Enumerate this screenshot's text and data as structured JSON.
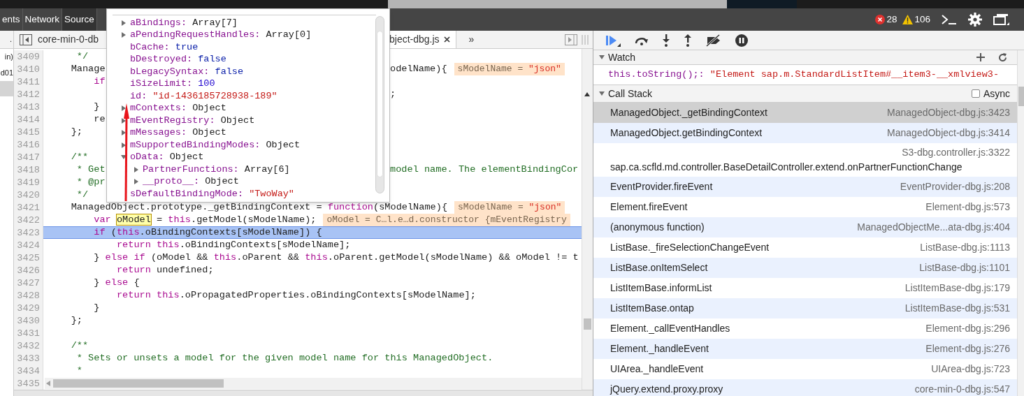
{
  "main_toolbar": {
    "tabs": [
      {
        "label": "ents",
        "selected": false
      },
      {
        "label": "Network",
        "selected": false
      },
      {
        "label": "Source",
        "selected": true
      }
    ],
    "errors": "28",
    "warnings": "106"
  },
  "navigator": {
    "header": ".",
    "items": [
      {
        "label": "in)",
        "selected": false
      },
      {
        "label": "d01",
        "selected": false
      }
    ]
  },
  "editor_tabs": [
    {
      "label": "core-min-0-db",
      "selected": false
    },
    {
      "label": "bject-dbg.js",
      "selected": true
    }
  ],
  "more_tabs": "»",
  "code": {
    "lines": [
      {
        "number": "3409",
        "kind": "comment",
        "text": "     */",
        "current": false
      },
      {
        "number": "3410",
        "kind": "code",
        "text": "    Manage",
        "right": "odelName){",
        "inline": {
          "name": "sModelName =",
          "value": "\"json\""
        },
        "current": false
      },
      {
        "number": "3411",
        "kind": "code",
        "text": "        if",
        "current": false
      },
      {
        "number": "3412",
        "kind": "code",
        "right": ";",
        "current": false
      },
      {
        "number": "3413",
        "kind": "code",
        "text": "        }",
        "current": false
      },
      {
        "number": "3414",
        "kind": "code",
        "text": "        re",
        "current": false
      },
      {
        "number": "3415",
        "kind": "code",
        "text": "    };",
        "current": false
      },
      {
        "number": "3416",
        "kind": "blank",
        "current": false
      },
      {
        "number": "3417",
        "kind": "comment",
        "text": "    /**",
        "current": false
      },
      {
        "number": "3418",
        "kind": "comment",
        "text": "     * Get",
        "right": "model name. The elementBindingCor",
        "current": false
      },
      {
        "number": "3419",
        "kind": "comment",
        "text": "     * @pr",
        "current": false
      },
      {
        "number": "3420",
        "kind": "comment",
        "text": "     */",
        "current": false
      },
      {
        "number": "3421",
        "kind": "code",
        "text": "    ManagedObject.prototype._getBindingContext = function(sModelName){",
        "inline": {
          "name": "sModelName =",
          "value": "\"json\""
        },
        "current": false
      },
      {
        "number": "3422",
        "kind": "code",
        "text": "        var ",
        "highlight": "oModel",
        "text_after": " = this.getModel(sModelName);",
        "inline": {
          "name": "oModel = C…l.e…d.constructor {mEventRegistry"
        },
        "current": false
      },
      {
        "number": "3423",
        "kind": "code",
        "text": "        if (this.oBindingContexts[sModelName]) {",
        "current": true
      },
      {
        "number": "3424",
        "kind": "code",
        "text": "            return this.oBindingContexts[sModelName];",
        "current": false
      },
      {
        "number": "3425",
        "kind": "code",
        "text": "        } else if (oModel && this.oParent && this.oParent.getModel(sModelName) && oModel != t",
        "current": false
      },
      {
        "number": "3426",
        "kind": "code",
        "text": "            return undefined;",
        "current": false
      },
      {
        "number": "3427",
        "kind": "code",
        "text": "        } else {",
        "current": false
      },
      {
        "number": "3428",
        "kind": "code",
        "text": "            return this.oPropagatedProperties.oBindingContexts[sModelName];",
        "current": false
      },
      {
        "number": "3429",
        "kind": "code",
        "text": "        }",
        "current": false
      },
      {
        "number": "3430",
        "kind": "code",
        "text": "    };",
        "current": false
      },
      {
        "number": "3431",
        "kind": "blank",
        "current": false
      },
      {
        "number": "3432",
        "kind": "comment",
        "text": "    /**",
        "current": false
      },
      {
        "number": "3433",
        "kind": "comment",
        "text": "     * Sets or unsets a model for the given model name for this ManagedObject.",
        "current": false
      },
      {
        "number": "3434",
        "kind": "comment",
        "text": "     *",
        "current": false
      },
      {
        "number": "3435",
        "kind": "scrollbar",
        "current": false
      }
    ]
  },
  "popover": {
    "entries": [
      {
        "key": "aBindings:",
        "value": "Array[7]",
        "kind": "object",
        "expanded": false
      },
      {
        "key": "aPendingRequestHandles:",
        "value": "Array[0]",
        "kind": "object",
        "expanded": false
      },
      {
        "key": "bCache:",
        "value": "true",
        "kind": "keyword"
      },
      {
        "key": "bDestroyed:",
        "value": "false",
        "kind": "keyword"
      },
      {
        "key": "bLegacySyntax:",
        "value": "false",
        "kind": "keyword"
      },
      {
        "key": "iSizeLimit:",
        "value": "100",
        "kind": "number"
      },
      {
        "key": "id:",
        "value": "\"id-1436185728938-189\"",
        "kind": "string"
      },
      {
        "key": "mContexts:",
        "value": "Object",
        "kind": "object",
        "expanded": false
      },
      {
        "key": "mEventRegistry:",
        "value": "Object",
        "kind": "object",
        "expanded": false
      },
      {
        "key": "mMessages:",
        "value": "Object",
        "kind": "object",
        "expanded": false
      },
      {
        "key": "mSupportedBindingModes:",
        "value": "Object",
        "kind": "object",
        "expanded": false
      },
      {
        "key": "oData:",
        "value": "Object",
        "kind": "object",
        "expanded": true,
        "children": [
          {
            "key": "PartnerFunctions:",
            "value": "Array[6]",
            "kind": "object",
            "expanded": false
          },
          {
            "key": "__proto__:",
            "value": "Object",
            "kind": "object",
            "expanded": false
          }
        ]
      },
      {
        "key": "sDefaultBindingMode:",
        "value": "\"TwoWay\"",
        "kind": "string"
      }
    ]
  },
  "watch": {
    "title": "Watch",
    "expanded": true,
    "expressions": [
      {
        "expression": "this.toString();:",
        "value": "\"Element sap.m.StandardListItem#__item3-__xmlview3-"
      }
    ]
  },
  "call_stack": {
    "title": "Call Stack",
    "expanded": true,
    "async_label": "Async",
    "async": false,
    "frames": [
      {
        "kind": "inline",
        "function": "ManagedObject._getBindingContext",
        "location": "ManagedObject-dbg.js:3423",
        "selected": true
      },
      {
        "kind": "inline",
        "function": "ManagedObject.getBindingContext",
        "location": "ManagedObject-dbg.js:3414",
        "selected": false
      },
      {
        "kind": "stacked",
        "location": "S3-dbg.controller.js:3322",
        "function": "sap.ca.scfld.md.controller.BaseDetailController.extend.onPartnerFunctionChange",
        "selected": false
      },
      {
        "kind": "inline",
        "function": "EventProvider.fireEvent",
        "location": "EventProvider-dbg.js:208",
        "selected": false
      },
      {
        "kind": "inline",
        "function": "Element.fireEvent",
        "location": "Element-dbg.js:573",
        "selected": false
      },
      {
        "kind": "inline",
        "function": "(anonymous function)",
        "location": "ManagedObjectMe...ata-dbg.js:404",
        "selected": false
      },
      {
        "kind": "inline",
        "function": "ListBase._fireSelectionChangeEvent",
        "location": "ListBase-dbg.js:1113",
        "selected": false
      },
      {
        "kind": "inline",
        "function": "ListBase.onItemSelect",
        "location": "ListBase-dbg.js:1101",
        "selected": false
      },
      {
        "kind": "inline",
        "function": "ListItemBase.informList",
        "location": "ListItemBase-dbg.js:179",
        "selected": false
      },
      {
        "kind": "inline",
        "function": "ListItemBase.ontap",
        "location": "ListItemBase-dbg.js:531",
        "selected": false
      },
      {
        "kind": "inline",
        "function": "Element._callEventHandles",
        "location": "Element-dbg.js:296",
        "selected": false
      },
      {
        "kind": "inline",
        "function": "Element._handleEvent",
        "location": "Element-dbg.js:276",
        "selected": false
      },
      {
        "kind": "inline",
        "function": "UIArea._handleEvent",
        "location": "UIArea-dbg.js:723",
        "selected": false
      },
      {
        "kind": "inline",
        "function": "jQuery.extend.proxy.proxy",
        "location": "core-min-0-dbg.js:547",
        "selected": false
      }
    ]
  }
}
